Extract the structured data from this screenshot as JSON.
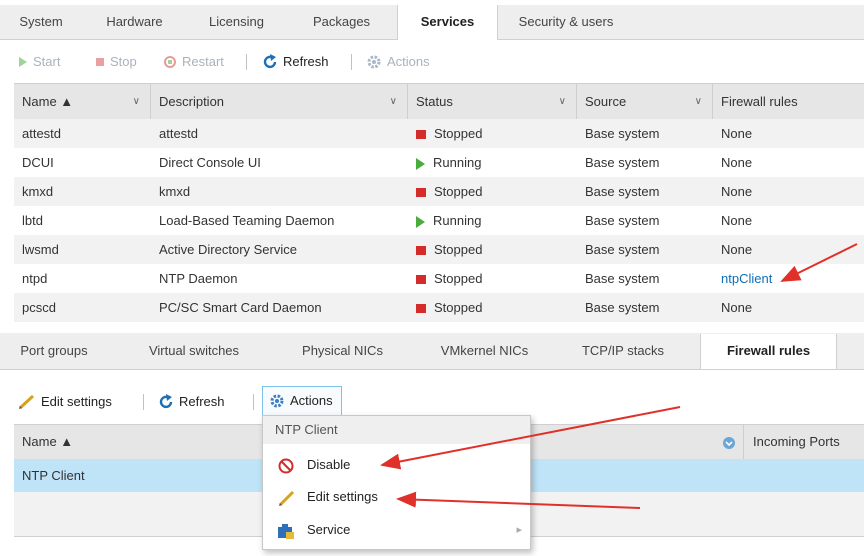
{
  "top_tabs": [
    "System",
    "Hardware",
    "Licensing",
    "Packages",
    "Services",
    "Security & users"
  ],
  "top_active": "Services",
  "services_toolbar": {
    "start": "Start",
    "stop": "Stop",
    "restart": "Restart",
    "refresh": "Refresh",
    "actions": "Actions"
  },
  "services_columns": [
    "Name ▲",
    "Description",
    "Status",
    "Source",
    "Firewall rules"
  ],
  "services_rows": [
    {
      "name": "attestd",
      "description": "attestd",
      "status": "Stopped",
      "source": "Base system",
      "firewall": "None"
    },
    {
      "name": "DCUI",
      "description": "Direct Console UI",
      "status": "Running",
      "source": "Base system",
      "firewall": "None"
    },
    {
      "name": "kmxd",
      "description": "kmxd",
      "status": "Stopped",
      "source": "Base system",
      "firewall": "None"
    },
    {
      "name": "lbtd",
      "description": "Load-Based Teaming Daemon",
      "status": "Running",
      "source": "Base system",
      "firewall": "None"
    },
    {
      "name": "lwsmd",
      "description": "Active Directory Service",
      "status": "Stopped",
      "source": "Base system",
      "firewall": "None"
    },
    {
      "name": "ntpd",
      "description": "NTP Daemon",
      "status": "Stopped",
      "source": "Base system",
      "firewall": "ntpClient"
    },
    {
      "name": "pcscd",
      "description": "PC/SC Smart Card Daemon",
      "status": "Stopped",
      "source": "Base system",
      "firewall": "None"
    }
  ],
  "net_tabs": [
    "Port groups",
    "Virtual switches",
    "Physical NICs",
    "VMkernel NICs",
    "TCP/IP stacks",
    "Firewall rules"
  ],
  "net_active": "Firewall rules",
  "fw_toolbar": {
    "edit": "Edit settings",
    "refresh": "Refresh",
    "actions": "Actions"
  },
  "fw_columns": {
    "name": "Name ▲",
    "incoming": "Incoming Ports"
  },
  "fw_rows": [
    {
      "name": "NTP Client"
    }
  ],
  "context_menu": {
    "title": "NTP Client",
    "items": [
      "Disable",
      "Edit settings",
      "Service"
    ]
  },
  "colors": {
    "stopped": "#d42b2b",
    "running": "#4cab3f",
    "link": "#0f6eb5",
    "selected_row": "#bfe3f7",
    "annotation_arrow": "#e0302a"
  }
}
